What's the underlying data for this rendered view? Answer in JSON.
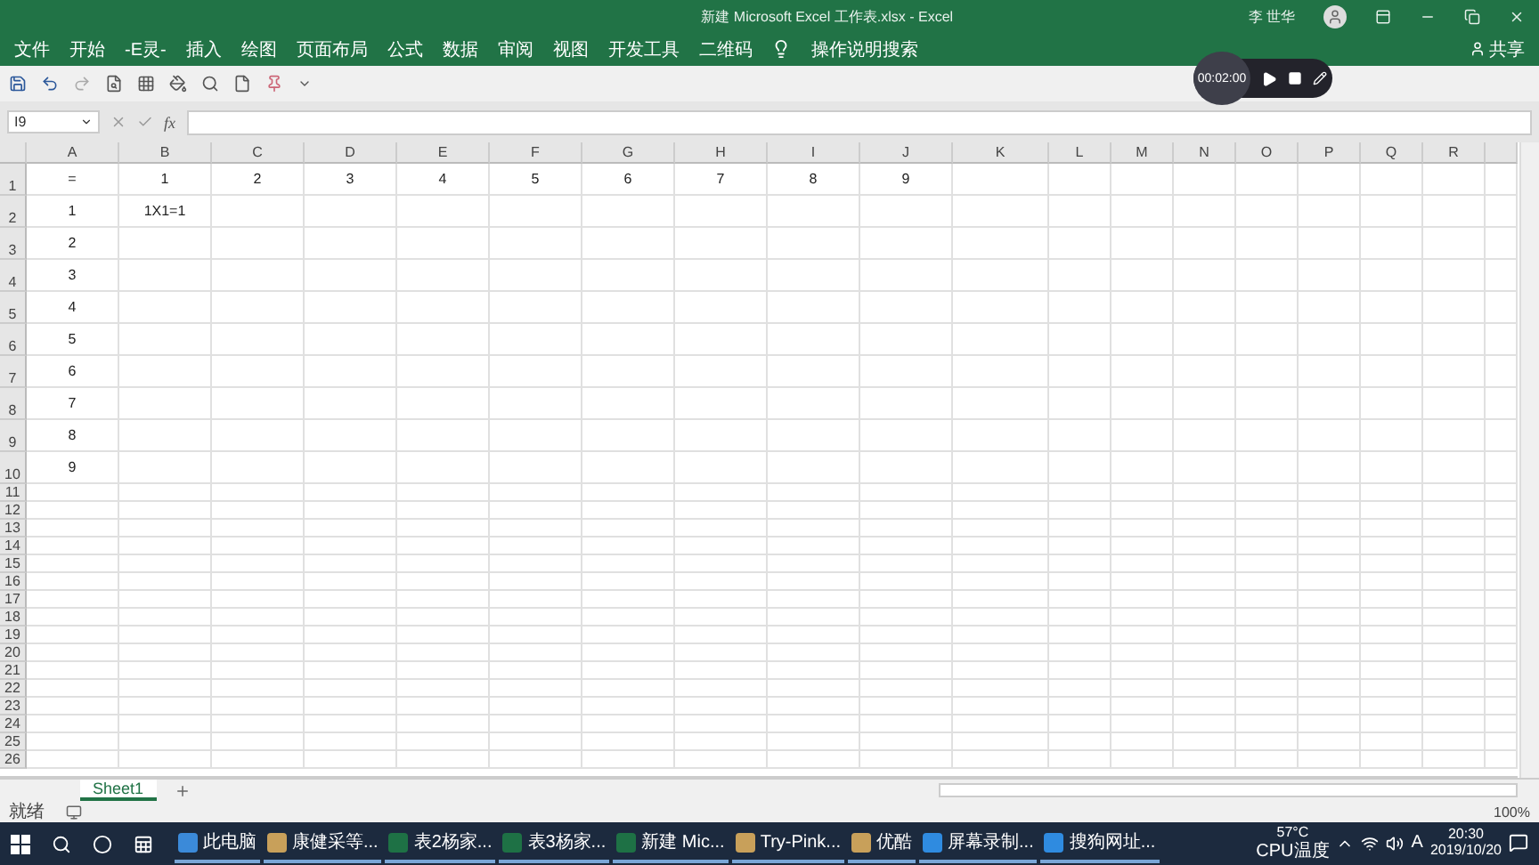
{
  "window": {
    "title": "新建 Microsoft Excel 工作表.xlsx  -  Excel",
    "user": "李 世华",
    "share": "共享"
  },
  "ribbon_tabs": [
    "文件",
    "开始",
    "-E灵-",
    "插入",
    "绘图",
    "页面布局",
    "公式",
    "数据",
    "审阅",
    "视图",
    "开发工具",
    "二维码"
  ],
  "search_hint": "操作说明搜索",
  "recorder": {
    "time": "00:02:00"
  },
  "name_box": "I9",
  "formula_label": "fx",
  "columns": [
    "A",
    "B",
    "C",
    "D",
    "E",
    "F",
    "G",
    "H",
    "I",
    "J",
    "K",
    "L",
    "M",
    "N",
    "O",
    "P",
    "Q",
    "R"
  ],
  "rows": [
    {
      "header": "1",
      "cells": [
        "=",
        "1",
        "2",
        "3",
        "4",
        "5",
        "6",
        "7",
        "8",
        "9"
      ]
    },
    {
      "header": "2",
      "cells": [
        "1",
        "1X1=1"
      ]
    },
    {
      "header": "3",
      "cells": [
        "2"
      ]
    },
    {
      "header": "4",
      "cells": [
        "3"
      ]
    },
    {
      "header": "5",
      "cells": [
        "4"
      ]
    },
    {
      "header": "6",
      "cells": [
        "5"
      ]
    },
    {
      "header": "7",
      "cells": [
        "6"
      ]
    },
    {
      "header": "8",
      "cells": [
        "7"
      ]
    },
    {
      "header": "9",
      "cells": [
        "8"
      ]
    },
    {
      "header": "10",
      "cells": [
        "9"
      ]
    },
    {
      "header": "11"
    },
    {
      "header": "12"
    },
    {
      "header": "13"
    },
    {
      "header": "14"
    },
    {
      "header": "15"
    },
    {
      "header": "16"
    },
    {
      "header": "17"
    },
    {
      "header": "18"
    },
    {
      "header": "19"
    },
    {
      "header": "20"
    },
    {
      "header": "21"
    },
    {
      "header": "22"
    },
    {
      "header": "23"
    },
    {
      "header": "24"
    },
    {
      "header": "25"
    },
    {
      "header": "26"
    }
  ],
  "sheet_tabs": [
    {
      "label": "Sheet1",
      "selected": true
    }
  ],
  "status": {
    "text": "就绪",
    "zoom": "100%"
  },
  "taskbar": [
    {
      "label": "此电脑",
      "kind": "pc"
    },
    {
      "label": "康健采等...",
      "kind": "app"
    },
    {
      "label": "表2杨家...",
      "kind": "excel"
    },
    {
      "label": "表3杨家...",
      "kind": "excel"
    },
    {
      "label": "新建 Mic...",
      "kind": "excel"
    },
    {
      "label": "Try-Pink...",
      "kind": "app"
    },
    {
      "label": "优酷",
      "kind": "app"
    },
    {
      "label": "屏幕录制...",
      "kind": "browser"
    },
    {
      "label": "搜狗网址...",
      "kind": "browser"
    }
  ],
  "tray": {
    "temp": "57°C",
    "temp_label": "CPU温度",
    "ime": "A",
    "time": "20:30",
    "date": "2019/10/20"
  }
}
